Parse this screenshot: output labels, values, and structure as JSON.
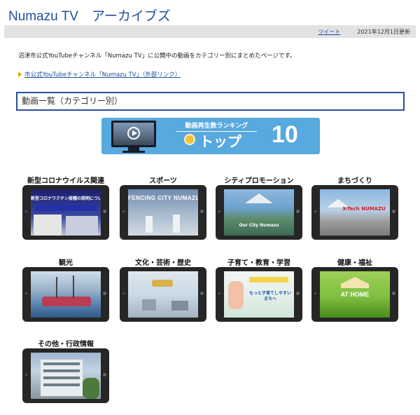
{
  "header": {
    "title": "Numazu TV　アーカイブズ"
  },
  "meta": {
    "tweet_label": "ツイート",
    "updated": "2021年12月1日更新"
  },
  "intro": {
    "text": "沼津市公式YouTubeチャンネル「Numazu TV」に公開中の動画をカテゴリー別にまとめたページです。",
    "link_label": "市公式YouTubeチャンネル「Numazu TV」（外部リンク）"
  },
  "section": {
    "heading": "動画一覧（カテゴリー別）"
  },
  "banner": {
    "label": "動画再生数ランキング",
    "top_text": "トップ",
    "number": "10"
  },
  "categories": [
    {
      "title": "新型コロナウイルス関連",
      "thumb_text": "新型コロナワクチン接種の説明について",
      "colors": [
        "#1c1f6e",
        "#5d6bb8"
      ]
    },
    {
      "title": "スポーツ",
      "thumb_text": "FENCING CITY NUMAZU",
      "colors": [
        "#6f8bb0",
        "#c9d4df"
      ]
    },
    {
      "title": "シティプロモーション",
      "thumb_text": "Our City Numazu",
      "colors": [
        "#6ea3cf",
        "#3d6c55"
      ]
    },
    {
      "title": "まちづくり",
      "thumb_text": "X-Tech NUMAZU",
      "colors": [
        "#8cb8e0",
        "#8f8f8f"
      ]
    },
    {
      "title": "観光",
      "thumb_text": "",
      "colors": [
        "#5b86b4",
        "#b93d52"
      ]
    },
    {
      "title": "文化・芸術・歴史",
      "thumb_text": "",
      "colors": [
        "#c9d9e6",
        "#8a9aa5"
      ]
    },
    {
      "title": "子育て・教育・学習",
      "thumb_text": "もっと子育てしやすいまちへ",
      "colors": [
        "#e6f0ea",
        "#bfe0cf"
      ]
    },
    {
      "title": "健康・福祉",
      "thumb_text": "AT HOME",
      "colors": [
        "#7fbf3f",
        "#4a8a1e"
      ]
    },
    {
      "title": "その他・行政情報",
      "thumb_text": "",
      "colors": [
        "#9fb6cf",
        "#6d7a86"
      ]
    }
  ],
  "icons": {
    "play": "play-icon",
    "crown": "crown-icon",
    "arrow": "arrow-right-icon"
  }
}
